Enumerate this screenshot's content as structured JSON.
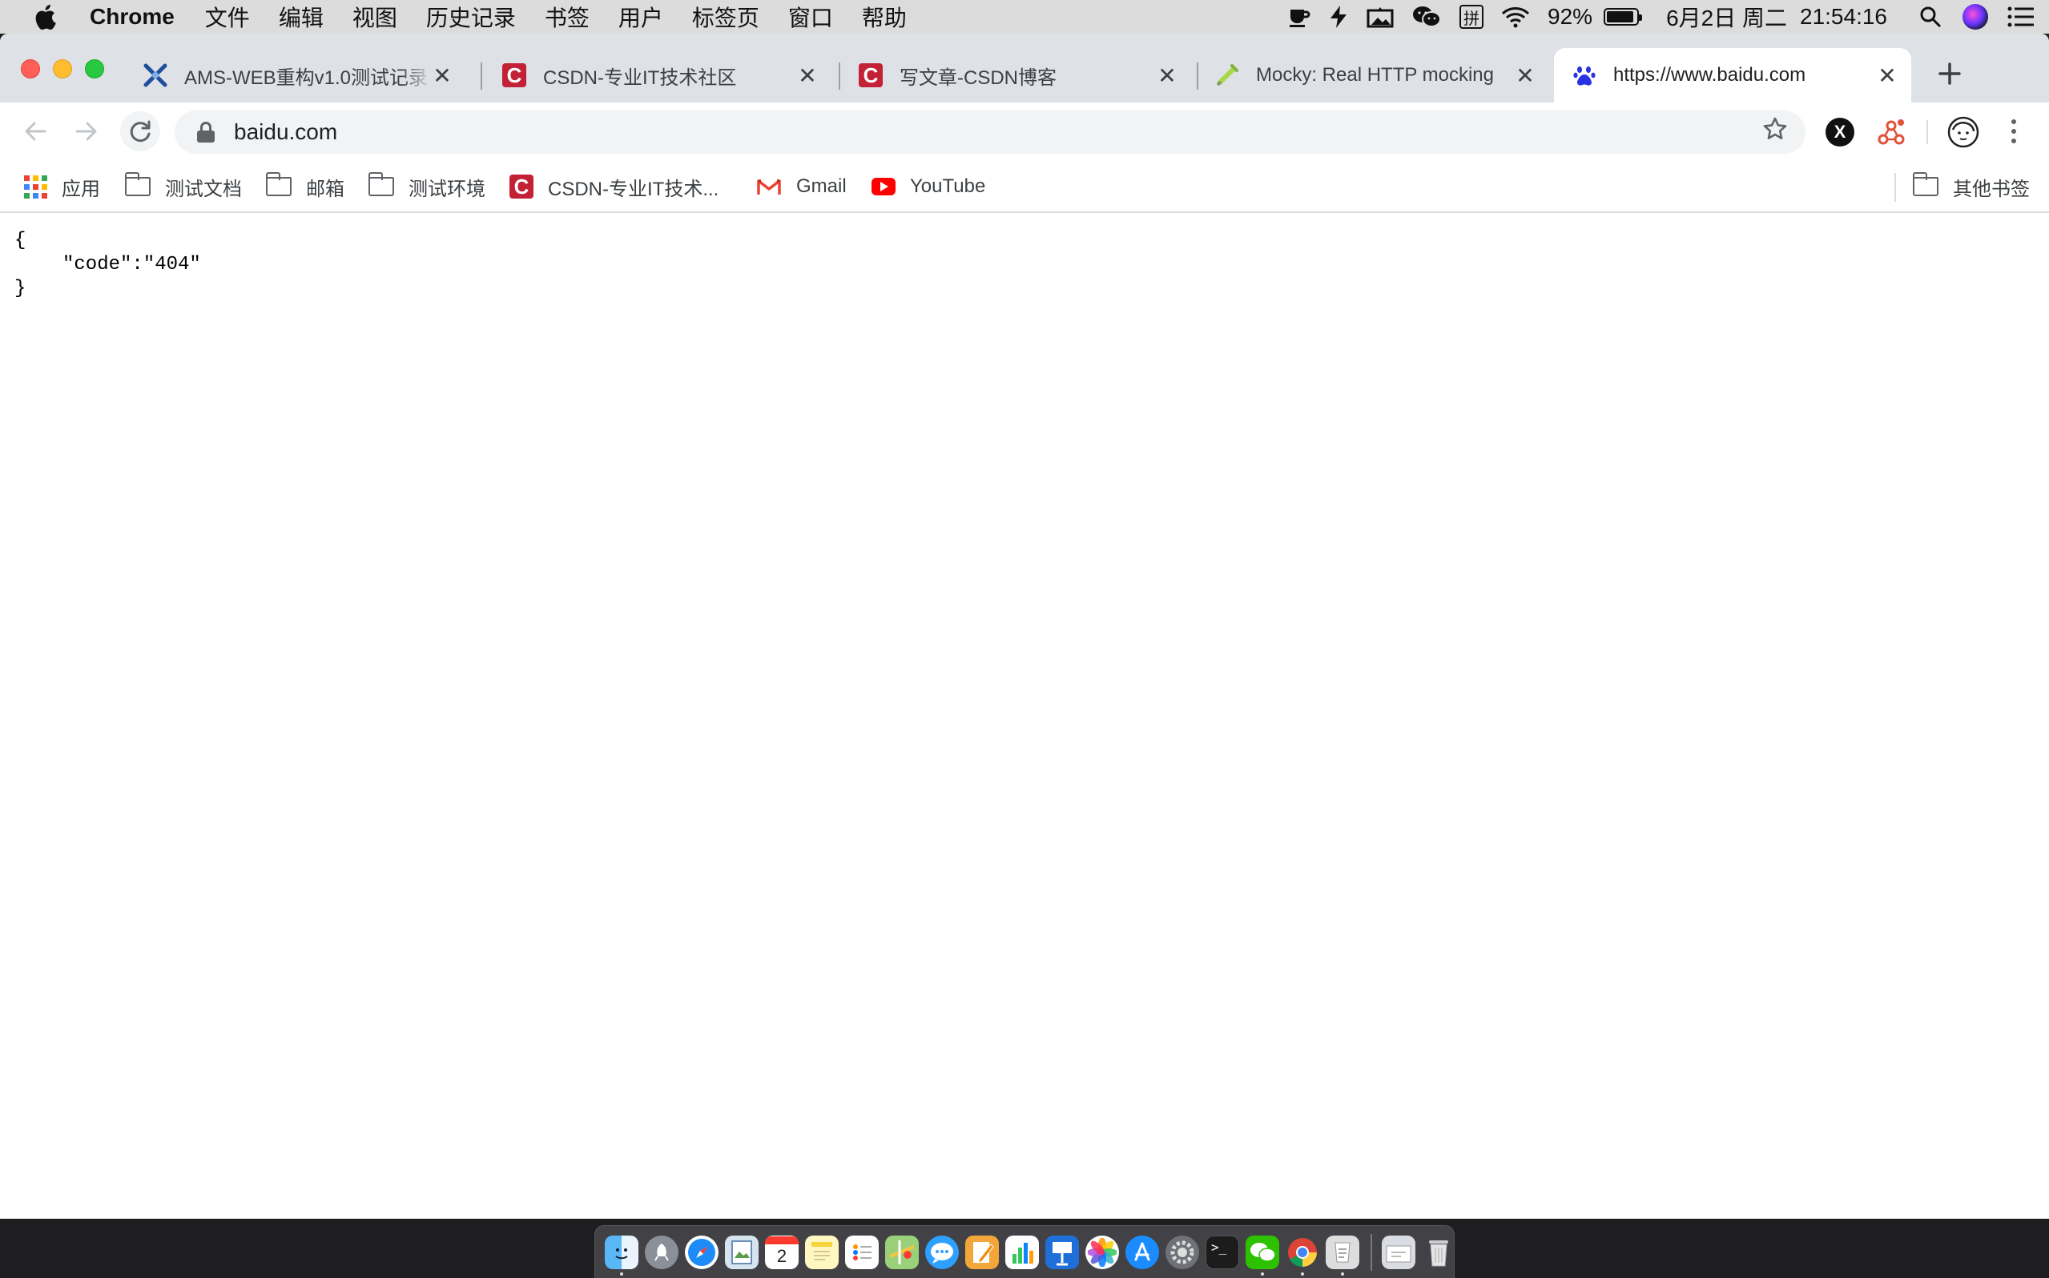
{
  "menubar": {
    "app_name": "Chrome",
    "menus": [
      "文件",
      "编辑",
      "视图",
      "历史记录",
      "书签",
      "用户",
      "标签页",
      "窗口",
      "帮助"
    ],
    "ime_label": "拼",
    "battery_percent": "92%",
    "battery_level": 0.92,
    "date": "6月2日 周二",
    "time": "21:54:16"
  },
  "tabs": [
    {
      "title": "AMS-WEB重构v1.0测试记录",
      "favicon": "ams-icon",
      "active": false
    },
    {
      "title": "CSDN-专业IT技术社区",
      "favicon": "csdn-icon",
      "active": false
    },
    {
      "title": "写文章-CSDN博客",
      "favicon": "csdn-icon",
      "active": false
    },
    {
      "title": "Mocky: Real HTTP mocking",
      "favicon": "mocky-icon",
      "active": false
    },
    {
      "title": "https://www.baidu.com",
      "favicon": "baidu-paw-icon",
      "active": true
    }
  ],
  "toolbar": {
    "url": "baidu.com"
  },
  "bookmarks": {
    "items": [
      {
        "label": "应用",
        "icon": "apps-grid-icon"
      },
      {
        "label": "测试文档",
        "icon": "folder-icon"
      },
      {
        "label": "邮箱",
        "icon": "folder-icon"
      },
      {
        "label": "测试环境",
        "icon": "folder-icon"
      },
      {
        "label": "CSDN-专业IT技术...",
        "icon": "csdn-icon"
      },
      {
        "label": "Gmail",
        "icon": "gmail-icon"
      },
      {
        "label": "YouTube",
        "icon": "youtube-icon"
      }
    ],
    "other_label": "其他书签"
  },
  "page": {
    "line1": "{",
    "line2": "\"code\":\"404\"",
    "line3": "}"
  },
  "dock": {
    "calendar_day": "2",
    "apps": [
      "finder",
      "launchpad",
      "safari",
      "preview",
      "calendar",
      "notes",
      "reminders",
      "maps",
      "messages",
      "pages",
      "numbers",
      "keynote",
      "photos",
      "app-store",
      "system-preferences",
      "terminal",
      "wechat",
      "chrome",
      "script-editor",
      "downloads",
      "trash"
    ]
  },
  "colors": {
    "tabstrip": "#dee1e6",
    "csdn_red": "#c32136",
    "youtube_red": "#ff0000",
    "baidu_blue": "#2932e1"
  }
}
